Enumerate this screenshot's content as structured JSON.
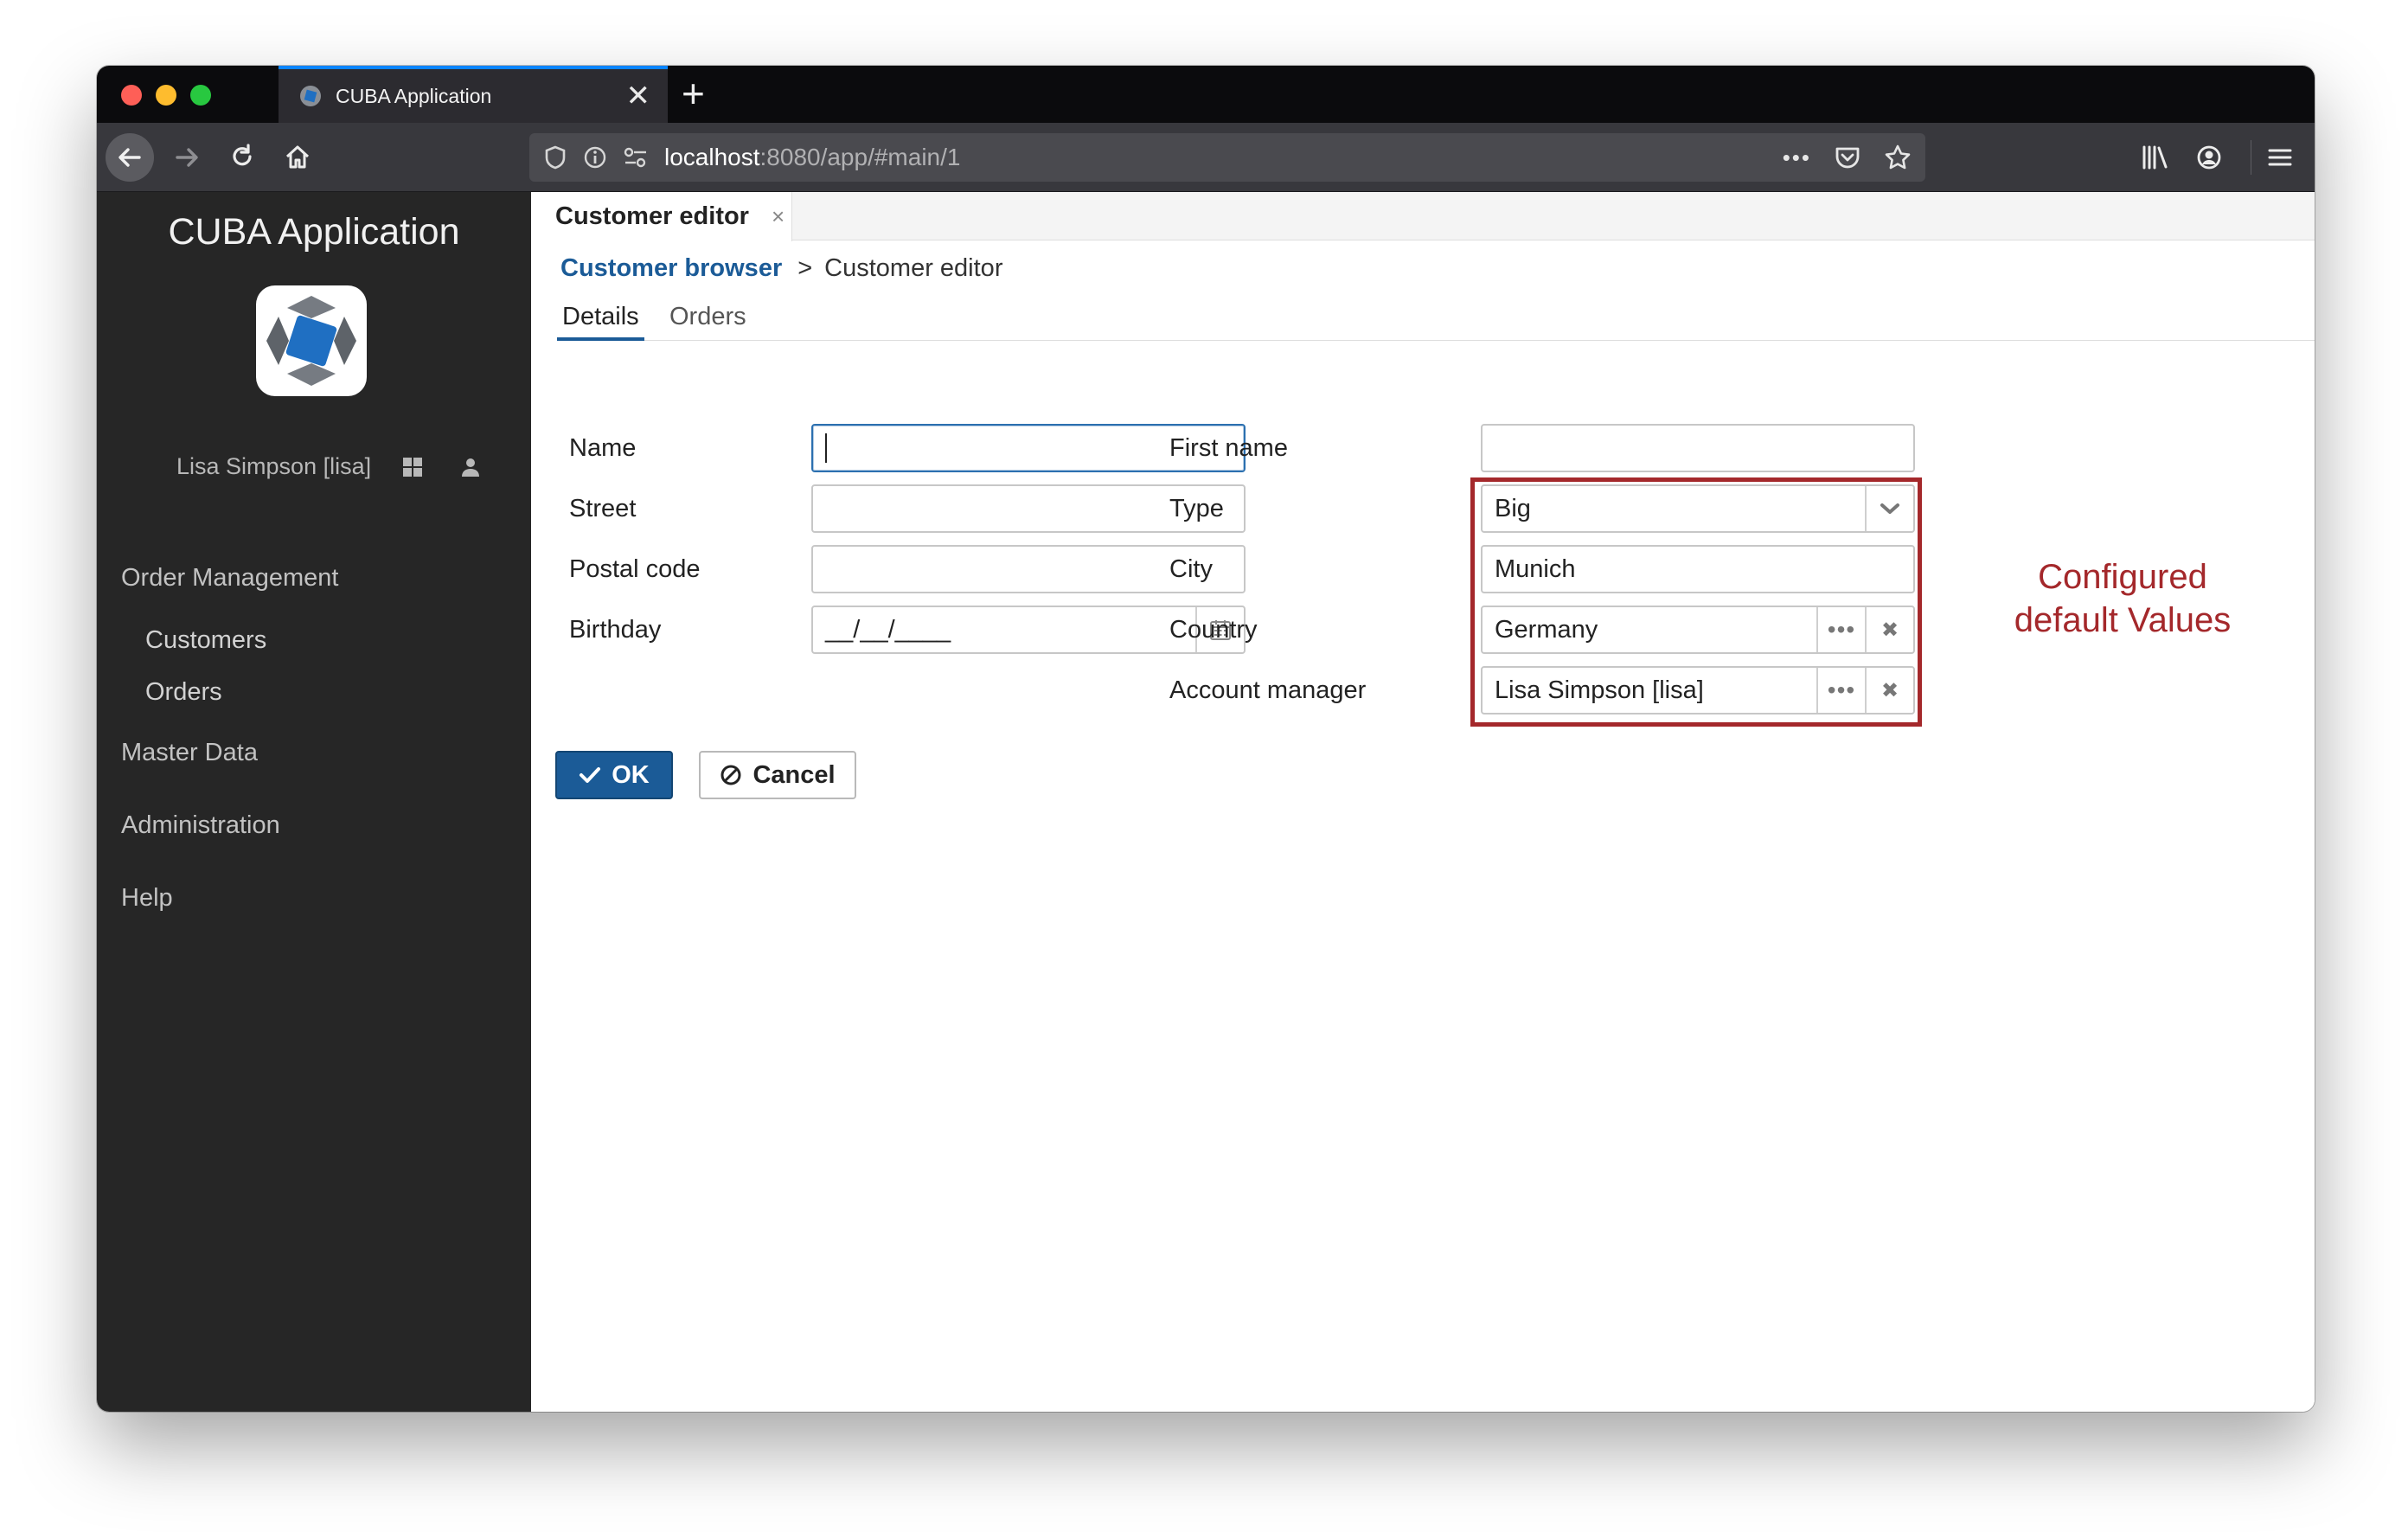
{
  "browser": {
    "tab_title": "CUBA Application",
    "new_tab_symbol": "+",
    "tab_close_symbol": "✕",
    "url_host": "localhost",
    "url_rest": ":8080/app/#main/1",
    "more_symbol": "•••"
  },
  "sidebar": {
    "app_title": "CUBA Application",
    "user_name": "Lisa Simpson [lisa]",
    "menu": [
      {
        "label": "Order Management"
      },
      {
        "label": "Customers"
      },
      {
        "label": "Orders"
      },
      {
        "label": "Master Data"
      },
      {
        "label": "Administration"
      },
      {
        "label": "Help"
      }
    ]
  },
  "window_tab": {
    "label": "Customer editor",
    "close_symbol": "×"
  },
  "breadcrumb": {
    "parent": "Customer browser",
    "separator": ">",
    "current": "Customer editor"
  },
  "subtabs": [
    {
      "label": "Details"
    },
    {
      "label": "Orders"
    }
  ],
  "form": {
    "name": {
      "label": "Name",
      "value": ""
    },
    "street": {
      "label": "Street",
      "value": ""
    },
    "postal_code": {
      "label": "Postal code",
      "value": ""
    },
    "birthday": {
      "label": "Birthday",
      "value": "__/__/____"
    },
    "first_name": {
      "label": "First name",
      "value": ""
    },
    "type": {
      "label": "Type",
      "value": "Big"
    },
    "city": {
      "label": "City",
      "value": "Munich"
    },
    "country": {
      "label": "Country",
      "value": "Germany"
    },
    "account_manager": {
      "label": "Account manager",
      "value": "Lisa Simpson [lisa]"
    },
    "picker_dots": "•••",
    "picker_clear": "✖"
  },
  "buttons": {
    "ok": "OK",
    "cancel": "Cancel"
  },
  "annotation": {
    "line1": "Configured",
    "line2": "default Values"
  },
  "colors": {
    "accent": "#1b5b97",
    "annotation": "#a4282b",
    "sidebar_bg": "#262626",
    "focus_border": "#2c70b0"
  },
  "icons": [
    "back-arrow-icon",
    "forward-arrow-icon",
    "reload-icon",
    "home-icon",
    "shield-icon",
    "info-icon",
    "permissions-icon",
    "pocket-icon",
    "star-icon",
    "library-icon",
    "account-icon",
    "hamburger-menu-icon",
    "apps-grid-icon",
    "user-icon",
    "calendar-icon",
    "chevron-down-icon",
    "check-icon",
    "ban-icon"
  ]
}
